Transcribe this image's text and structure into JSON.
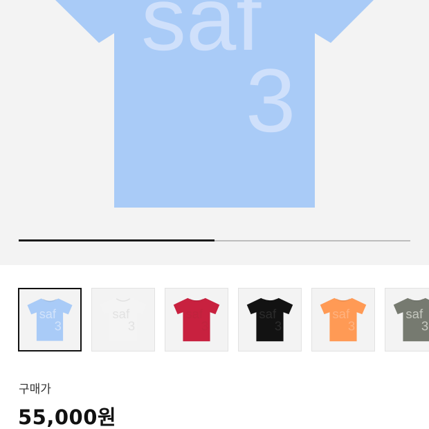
{
  "product": {
    "print_word": "saf",
    "print_number": "3",
    "main_color": "#a9cbf7",
    "main_print_color": "#cfe0fb"
  },
  "gallery": {
    "progress": 0.5,
    "selected_index": 0
  },
  "color_options": [
    {
      "name": "light-blue",
      "shirt": "#a9cbf7",
      "print": "#d2e3fb"
    },
    {
      "name": "white",
      "shirt": "#f4f4f4",
      "print": "#e2e2e2"
    },
    {
      "name": "red",
      "shirt": "#c8213f",
      "print": "#c0233d"
    },
    {
      "name": "black",
      "shirt": "#121212",
      "print": "#2c2c2c"
    },
    {
      "name": "orange",
      "shirt": "#ff9a55",
      "print": "#ffb27f"
    },
    {
      "name": "olive-gray",
      "shirt": "#767a70",
      "print": "#c5c8bf"
    }
  ],
  "price": {
    "label": "구매가",
    "value": "55,000원"
  }
}
